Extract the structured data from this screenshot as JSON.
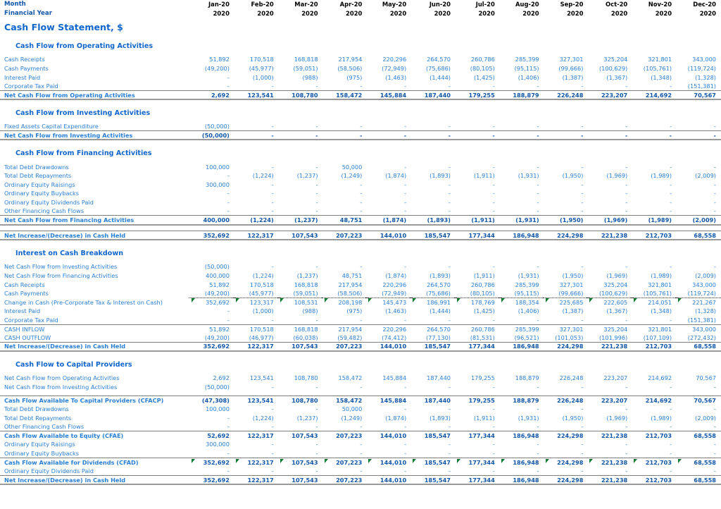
{
  "header": {
    "month_label": "Month",
    "fy_label": "Financial Year",
    "months": [
      "Jan-20",
      "Feb-20",
      "Mar-20",
      "Apr-20",
      "May-20",
      "Jun-20",
      "Jul-20",
      "Aug-20",
      "Sep-20",
      "Oct-20",
      "Nov-20",
      "Dec-20"
    ],
    "years": [
      "2020",
      "2020",
      "2020",
      "2020",
      "2020",
      "2020",
      "2020",
      "2020",
      "2020",
      "2020",
      "2020",
      "2020"
    ]
  },
  "title": "Cash Flow Statement, $",
  "sections": {
    "operating": {
      "heading": "Cash Flow from Operating Activities",
      "rows": [
        {
          "label": "Cash Receipts",
          "values": [
            "51,892",
            "170,518",
            "168,818",
            "217,954",
            "220,296",
            "264,570",
            "260,786",
            "285,399",
            "327,301",
            "325,204",
            "321,801",
            "343,000"
          ]
        },
        {
          "label": "Cash Payments",
          "values": [
            "(49,200)",
            "(45,977)",
            "(59,051)",
            "(58,506)",
            "(72,949)",
            "(75,686)",
            "(80,105)",
            "(95,115)",
            "(99,666)",
            "(100,629)",
            "(105,761)",
            "(119,724)"
          ]
        },
        {
          "label": "Interest Paid",
          "values": [
            "-",
            "(1,000)",
            "(988)",
            "(975)",
            "(1,463)",
            "(1,444)",
            "(1,425)",
            "(1,406)",
            "(1,387)",
            "(1,367)",
            "(1,348)",
            "(1,328)"
          ]
        },
        {
          "label": "Corporate Tax Paid",
          "values": [
            "-",
            "-",
            "-",
            "-",
            "-",
            "-",
            "-",
            "-",
            "-",
            "-",
            "-",
            "(151,381)"
          ]
        }
      ],
      "total": {
        "label": "Net Cash Flow from Operating Activities",
        "values": [
          "2,692",
          "123,541",
          "108,780",
          "158,472",
          "145,884",
          "187,440",
          "179,255",
          "188,879",
          "226,248",
          "223,207",
          "214,692",
          "70,567"
        ]
      }
    },
    "investing": {
      "heading": "Cash Flow from Investing Activities",
      "rows": [
        {
          "label": "Fixed Assets Capital Expenditure",
          "values": [
            "(50,000)",
            "-",
            "-",
            "-",
            "-",
            "-",
            "-",
            "-",
            "-",
            "-",
            "-",
            "-"
          ]
        }
      ],
      "total": {
        "label": "Net Cash Flow from Investing Activities",
        "values": [
          "(50,000)",
          "-",
          "-",
          "-",
          "-",
          "-",
          "-",
          "-",
          "-",
          "-",
          "-",
          "-"
        ]
      }
    },
    "financing": {
      "heading": "Cash Flow from Financing Activities",
      "rows": [
        {
          "label": "Total Debt Drawdowns",
          "values": [
            "100,000",
            "-",
            "-",
            "50,000",
            "-",
            "-",
            "-",
            "-",
            "-",
            "-",
            "-",
            "-"
          ]
        },
        {
          "label": "Total Debt Repayments",
          "values": [
            "-",
            "(1,224)",
            "(1,237)",
            "(1,249)",
            "(1,874)",
            "(1,893)",
            "(1,911)",
            "(1,931)",
            "(1,950)",
            "(1,969)",
            "(1,989)",
            "(2,009)"
          ]
        },
        {
          "label": "Ordinary Equity Raisings",
          "values": [
            "300,000",
            "-",
            "-",
            "-",
            "-",
            "-",
            "-",
            "-",
            "-",
            "-",
            "-",
            "-"
          ]
        },
        {
          "label": "Ordinary Equity Buybacks",
          "values": [
            "-",
            "-",
            "-",
            "-",
            "-",
            "-",
            "-",
            "-",
            "-",
            "-",
            "-",
            "-"
          ]
        },
        {
          "label": "Ordinary Equity Dividends Paid",
          "values": [
            "-",
            "-",
            "-",
            "-",
            "-",
            "-",
            "-",
            "-",
            "-",
            "-",
            "-",
            "-"
          ]
        },
        {
          "label": "Other Financing Cash Flows",
          "values": [
            "-",
            "-",
            "-",
            "-",
            "-",
            "-",
            "-",
            "-",
            "-",
            "-",
            "-",
            "-"
          ]
        }
      ],
      "total": {
        "label": "Net Cash Flow from Financing Activities",
        "values": [
          "400,000",
          "(1,224)",
          "(1,237)",
          "48,751",
          "(1,874)",
          "(1,893)",
          "(1,911)",
          "(1,931)",
          "(1,950)",
          "(1,969)",
          "(1,989)",
          "(2,009)"
        ]
      }
    },
    "net_increase_1": {
      "label": "Net Increase/(Decrease) in Cash Held",
      "values": [
        "352,692",
        "122,317",
        "107,543",
        "207,223",
        "144,010",
        "185,547",
        "177,344",
        "186,948",
        "224,298",
        "221,238",
        "212,703",
        "68,558"
      ]
    },
    "interest_breakdown": {
      "heading": "Interest on Cash Breakdown",
      "rows": [
        {
          "label": "Net Cash Flow from Investing Activities",
          "values": [
            "(50,000)",
            "-",
            "-",
            "-",
            "-",
            "-",
            "-",
            "-",
            "-",
            "-",
            "-",
            "-"
          ]
        },
        {
          "label": "Net Cash Flow from Financing Activities",
          "values": [
            "400,000",
            "(1,224)",
            "(1,237)",
            "48,751",
            "(1,874)",
            "(1,893)",
            "(1,911)",
            "(1,931)",
            "(1,950)",
            "(1,969)",
            "(1,989)",
            "(2,009)"
          ]
        },
        {
          "label": "Cash Receipts",
          "values": [
            "51,892",
            "170,518",
            "168,818",
            "217,954",
            "220,296",
            "264,570",
            "260,786",
            "285,399",
            "327,301",
            "325,204",
            "321,801",
            "343,000"
          ]
        },
        {
          "label": "Cash Payments",
          "values": [
            "(49,200)",
            "(45,977)",
            "(59,051)",
            "(58,506)",
            "(72,949)",
            "(75,686)",
            "(80,105)",
            "(95,115)",
            "(99,666)",
            "(100,629)",
            "(105,761)",
            "(119,724)"
          ]
        }
      ],
      "change_row": {
        "label": "Change in Cash (Pre-Corporate Tax & Interest on Cash)",
        "values": [
          "352,692",
          "123,317",
          "108,531",
          "208,198",
          "145,473",
          "186,991",
          "178,769",
          "188,354",
          "225,685",
          "222,605",
          "214,051",
          "221,267"
        ]
      },
      "rows2": [
        {
          "label": "Interest Paid",
          "values": [
            "-",
            "(1,000)",
            "(988)",
            "(975)",
            "(1,463)",
            "(1,444)",
            "(1,425)",
            "(1,406)",
            "(1,387)",
            "(1,367)",
            "(1,348)",
            "(1,328)"
          ]
        },
        {
          "label": "Corporate Tax Paid",
          "values": [
            "-",
            "-",
            "-",
            "-",
            "-",
            "-",
            "-",
            "-",
            "-",
            "-",
            "-",
            "(151,381)"
          ]
        }
      ],
      "inflow": {
        "label": "CASH INFLOW",
        "values": [
          "51,892",
          "170,518",
          "168,818",
          "217,954",
          "220,296",
          "264,570",
          "260,786",
          "285,399",
          "327,301",
          "325,204",
          "321,801",
          "343,000"
        ]
      },
      "outflow": {
        "label": "CASH OUTFLOW",
        "values": [
          "(49,200)",
          "(46,977)",
          "(60,038)",
          "(59,482)",
          "(74,412)",
          "(77,130)",
          "(81,531)",
          "(96,521)",
          "(101,053)",
          "(101,996)",
          "(107,109)",
          "(272,432)"
        ]
      },
      "total": {
        "label": "Net Increase/(Decrease) in Cash Held",
        "values": [
          "352,692",
          "122,317",
          "107,543",
          "207,223",
          "144,010",
          "185,547",
          "177,344",
          "186,948",
          "224,298",
          "221,238",
          "212,703",
          "68,558"
        ]
      }
    },
    "capital_providers": {
      "heading": "Cash Flow to Capital Providers",
      "rows": [
        {
          "label": "Net Cash Flow from Operating Activities",
          "values": [
            "2,692",
            "123,541",
            "108,780",
            "158,472",
            "145,884",
            "187,440",
            "179,255",
            "188,879",
            "226,248",
            "223,207",
            "214,692",
            "70,567"
          ]
        },
        {
          "label": "Net Cash Flow from Investing Activities",
          "values": [
            "(50,000)",
            "-",
            "-",
            "-",
            "-",
            "-",
            "-",
            "-",
            "-",
            "-",
            "-",
            "-"
          ]
        }
      ],
      "cfacp": {
        "label": "Cash Flow Available To Capital Providers (CFACP)",
        "values": [
          "(47,308)",
          "123,541",
          "108,780",
          "158,472",
          "145,884",
          "187,440",
          "179,255",
          "188,879",
          "226,248",
          "223,207",
          "214,692",
          "70,567"
        ]
      },
      "rows_debt": [
        {
          "label": "Total Debt Drawdowns",
          "values": [
            "100,000",
            "-",
            "-",
            "50,000",
            "-",
            "-",
            "-",
            "-",
            "-",
            "-",
            "-",
            "-"
          ]
        },
        {
          "label": "Total Debt Repayments",
          "values": [
            "-",
            "(1,224)",
            "(1,237)",
            "(1,249)",
            "(1,874)",
            "(1,893)",
            "(1,911)",
            "(1,931)",
            "(1,950)",
            "(1,969)",
            "(1,989)",
            "(2,009)"
          ]
        },
        {
          "label": "Other Financing Cash Flows",
          "values": [
            "-",
            "-",
            "-",
            "-",
            "-",
            "-",
            "-",
            "-",
            "-",
            "-",
            "-",
            "-"
          ]
        }
      ],
      "cfae": {
        "label": "Cash Flow Available to Equity (CFAE)",
        "values": [
          "52,692",
          "122,317",
          "107,543",
          "207,223",
          "144,010",
          "185,547",
          "177,344",
          "186,948",
          "224,298",
          "221,238",
          "212,703",
          "68,558"
        ]
      },
      "rows_equity": [
        {
          "label": "Ordinary Equity Raisings",
          "values": [
            "300,000",
            "-",
            "-",
            "-",
            "-",
            "-",
            "-",
            "-",
            "-",
            "-",
            "-",
            "-"
          ]
        },
        {
          "label": "Ordinary Equity Buybacks",
          "values": [
            "-",
            "-",
            "-",
            "-",
            "-",
            "-",
            "-",
            "-",
            "-",
            "-",
            "-",
            "-"
          ]
        }
      ],
      "cfad": {
        "label": "Cash Flow Available for Dividends (CFAD)",
        "values": [
          "352,692",
          "122,317",
          "107,543",
          "207,223",
          "144,010",
          "185,547",
          "177,344",
          "186,948",
          "224,298",
          "221,238",
          "212,703",
          "68,558"
        ]
      },
      "dividends": {
        "label": "Ordinary Equity Dividends Paid",
        "values": [
          "-",
          "-",
          "-",
          "-",
          "-",
          "-",
          "-",
          "-",
          "-",
          "-",
          "-",
          "-"
        ]
      },
      "total": {
        "label": "Net Increase/(Decrease) in Cash Held",
        "values": [
          "352,692",
          "122,317",
          "107,543",
          "207,223",
          "144,010",
          "185,547",
          "177,344",
          "186,948",
          "224,298",
          "221,238",
          "212,703",
          "68,558"
        ]
      }
    }
  }
}
